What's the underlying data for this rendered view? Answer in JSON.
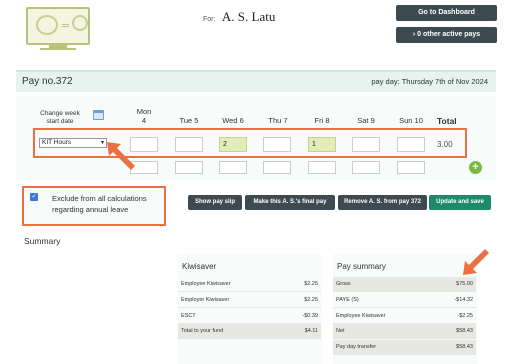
{
  "header": {
    "for_label": "For:",
    "employee_name": "A. S. Latu",
    "dashboard_button": "Go to Dashboard",
    "active_pays_button": "0 other active pays",
    "active_pays_icon": "chevron-right-icon"
  },
  "pay": {
    "number": "Pay no.372",
    "pay_day_label": "pay day:",
    "pay_day": "Thursday 7th of Nov 2024"
  },
  "grid": {
    "change_week_label": "Change week start date",
    "days": [
      {
        "name": "Mon",
        "num": "4",
        "value": ""
      },
      {
        "name": "Tue",
        "num": "5",
        "value": ""
      },
      {
        "name": "Wed",
        "num": "6",
        "value": "2"
      },
      {
        "name": "Thu",
        "num": "7",
        "value": ""
      },
      {
        "name": "Fri",
        "num": "8",
        "value": "1"
      },
      {
        "name": "Sat",
        "num": "9",
        "value": ""
      },
      {
        "name": "Sun",
        "num": "10",
        "value": ""
      }
    ],
    "total_label": "Total",
    "row_type": "KIT Hours",
    "row_total": "3.00"
  },
  "exclude": {
    "checked": true,
    "label": "Exclude from all calculations regarding annual leave"
  },
  "actions": {
    "show_slip": "Show pay slip",
    "final_pay": "Make this A. S.'s final pay",
    "remove_prefix": "Remove A. S. from pay",
    "remove_num": "372",
    "update": "Update and save"
  },
  "summary": {
    "title": "Summary",
    "kiwisaver": {
      "title": "Kiwisaver",
      "rows": [
        {
          "label": "Employee Kiwisaver",
          "value": "$2.25"
        },
        {
          "label": "Employer Kiwisaver",
          "value": "$2.25"
        },
        {
          "label": "ESCT",
          "value": "-$0.39"
        },
        {
          "label": "Total to your fund",
          "value": "$4.11"
        }
      ]
    },
    "pay_summary": {
      "title": "Pay summary",
      "rows": [
        {
          "label": "Gross",
          "value": "$75.00"
        },
        {
          "label": "PAYE (S)",
          "value": "-$14.32"
        },
        {
          "label": "Employee Kiwisaver",
          "value": "-$2.25"
        },
        {
          "label": "Net",
          "value": "$58.43"
        },
        {
          "label": "Pay day transfer",
          "value": "$58.43"
        }
      ]
    }
  },
  "colors": {
    "accent_orange": "#ee6f43",
    "dark_button": "#3e4a52",
    "save_button": "#1f8a6a",
    "highlight_cell": "#e3edba"
  }
}
